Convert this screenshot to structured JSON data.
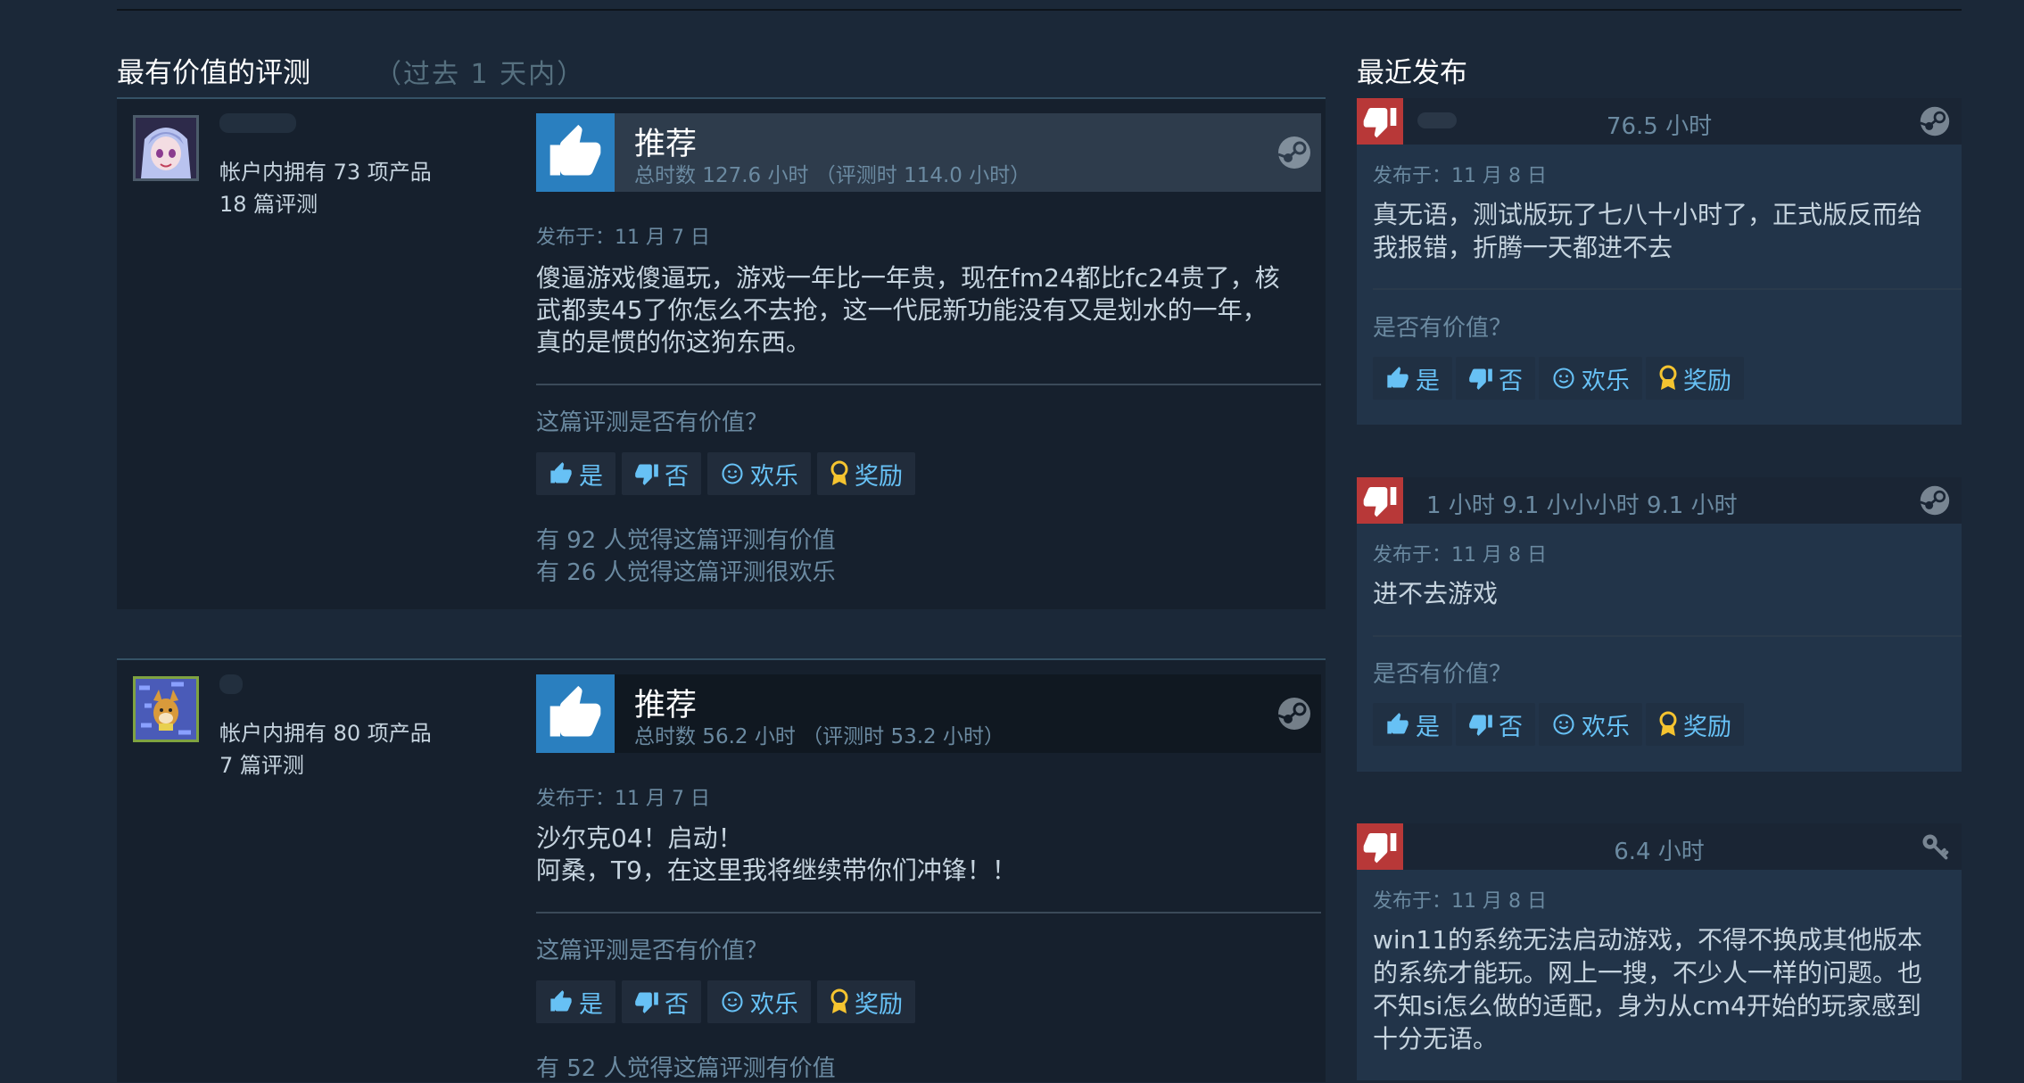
{
  "section": {
    "title": "最有价值的评测",
    "subtitle": "（过去 1 天内）"
  },
  "reviews": [
    {
      "owned": "帐户内拥有 73 项产品",
      "review_count": "18 篇评测",
      "verdict": "推荐",
      "hours": "总时数 127.6 小时 （评测时 114.0 小时）",
      "posted": "发布于：11 月 7 日",
      "text": "傻逼游戏傻逼玩，游戏一年比一年贵，现在fm24都比fc24贵了，核\n武都卖45了你怎么不去抢，这一代屁新功能没有又是划水的一年，\n真的是惯的你这狗东西。",
      "helpful_question": "这篇评测是否有价值？",
      "helpful_count": "有 92 人觉得这篇评测有价值",
      "funny_count": "有 26 人觉得这篇评测很欢乐"
    },
    {
      "owned": "帐户内拥有 80 项产品",
      "review_count": "7 篇评测",
      "verdict": "推荐",
      "hours": "总时数 56.2 小时 （评测时 53.2 小时）",
      "posted": "发布于：11 月 7 日",
      "text": "沙尔克04！启动！\n阿桑，T9，在这里我将继续带你们冲锋！！",
      "helpful_question": "这篇评测是否有价值？",
      "helpful_count": "有 52 人觉得这篇评测有价值"
    }
  ],
  "buttons": {
    "yes": "是",
    "no": "否",
    "funny": "欢乐",
    "award": "奖励"
  },
  "recent": {
    "title": "最近发布",
    "items": [
      {
        "hours": "76.5 小时",
        "posted": "发布于：11 月 8 日",
        "text": "真无语，测试版玩了七八十小时了，正式版反而给\n我报错，折腾一天都进不去",
        "question": "是否有价值？"
      },
      {
        "hours": "1 小时  9.1 小小小时    9.1 小时",
        "posted": "发布于：11 月 8 日",
        "text": "进不去游戏",
        "question": "是否有价值？"
      },
      {
        "hours": "6.4 小时",
        "posted": "发布于：11 月 8 日",
        "text": "win11的系统无法启动游戏，不得不换成其他版本\n的系统才能玩。网上一搜，不少人一样的问题。也\n不知si怎么做的适配，身为从cm4开始的玩家感到\n十分无语。"
      }
    ]
  },
  "colors": {
    "background": "#1b2838",
    "accent": "#67c1f5",
    "recommend": "#2a7fbf",
    "not_recommend": "#b83838",
    "award": "#f5c430"
  }
}
